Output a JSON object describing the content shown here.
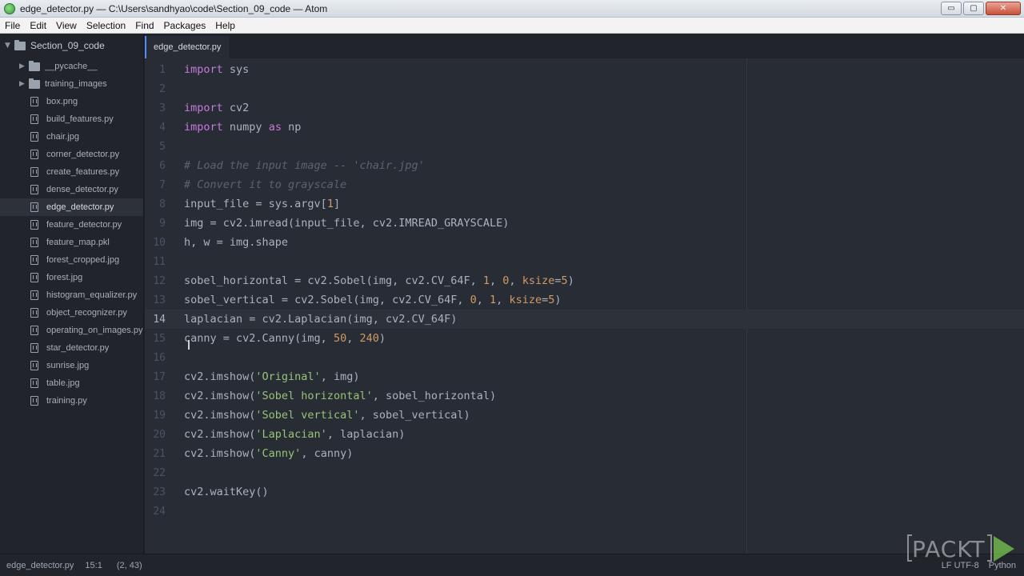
{
  "window": {
    "title": "edge_detector.py — C:\\Users\\sandhyao\\code\\Section_09_code — Atom",
    "buttons": {
      "minimize": "▭",
      "maximize": "▢",
      "close": "✕"
    }
  },
  "menu": [
    "File",
    "Edit",
    "View",
    "Selection",
    "Find",
    "Packages",
    "Help"
  ],
  "tree": {
    "root": "Section_09_code",
    "folders": [
      "__pycache__",
      "training_images"
    ],
    "files": [
      "box.png",
      "build_features.py",
      "chair.jpg",
      "corner_detector.py",
      "create_features.py",
      "dense_detector.py",
      "edge_detector.py",
      "feature_detector.py",
      "feature_map.pkl",
      "forest_cropped.jpg",
      "forest.jpg",
      "histogram_equalizer.py",
      "object_recognizer.py",
      "operating_on_images.py",
      "star_detector.py",
      "sunrise.jpg",
      "table.jpg",
      "training.py"
    ],
    "selected": "edge_detector.py"
  },
  "tab": {
    "label": "edge_detector.py"
  },
  "editor": {
    "line_numbers": [
      "1",
      "2",
      "3",
      "4",
      "5",
      "6",
      "7",
      "8",
      "9",
      "10",
      "11",
      "12",
      "13",
      "14",
      "15",
      "16",
      "17",
      "18",
      "19",
      "20",
      "21",
      "22",
      "23",
      "24"
    ],
    "cursor_line": 14
  },
  "status": {
    "file": "edge_detector.py",
    "position": "15:1",
    "selection": "(2, 43)",
    "encoding_partial": "LF  UTF-8",
    "grammar": "Python"
  },
  "watermark": {
    "text": "PACKT"
  },
  "colors": {
    "editor_bg": "#282c34",
    "keyword": "#c678dd",
    "comment": "#5c6370",
    "number": "#d19a66",
    "string": "#98c379",
    "accent": "#528bff"
  }
}
